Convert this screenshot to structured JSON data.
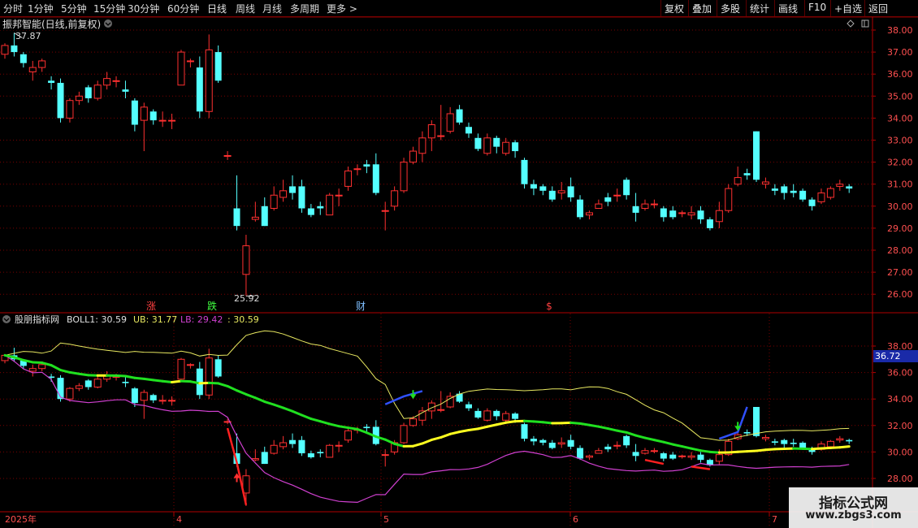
{
  "toolbar": {
    "periods": [
      "分时",
      "1分钟",
      "5分钟",
      "15分钟",
      "30分钟",
      "60分钟",
      "日线",
      "周线",
      "月线",
      "多周期",
      "更多 >"
    ],
    "active_period": "日线",
    "right_buttons": [
      "复权",
      "叠加",
      "多股",
      "统计",
      "画线",
      "F10",
      "+自选",
      "返回"
    ]
  },
  "main_panel": {
    "title": "振邦智能(日线,前复权)",
    "high_label": "37.87",
    "low_label": "25.92",
    "y_ticks": [
      "38.00",
      "37.00",
      "36.00",
      "35.00",
      "34.00",
      "33.00",
      "32.00",
      "31.00",
      "30.00",
      "29.00",
      "28.00",
      "27.00",
      "26.00"
    ],
    "event_markers": [
      {
        "text": "涨",
        "color": "#ff4040"
      },
      {
        "text": "跌",
        "color": "#40ff40"
      },
      {
        "text": "财",
        "color": "#7fbfff"
      },
      {
        "text": "$",
        "color": "#ff4040"
      }
    ]
  },
  "indicator_panel": {
    "name": "股朋指标网",
    "boll": "BOLL1: 30.59",
    "ub": "UB: 31.77",
    "lb": "LB: 29.42",
    "extra": ": 30.59",
    "y_ticks": [
      "38.00",
      "36.00",
      "34.00",
      "32.00",
      "30.00",
      "28.00"
    ],
    "current_price_label": "36.72"
  },
  "x_axis": {
    "labels": [
      "2025年",
      "4",
      "5",
      "6",
      "7"
    ]
  },
  "watermark": {
    "title": "指标公式网",
    "url": "www.zbgs3.com"
  },
  "colors": {
    "up": "#ff3030",
    "down": "#54ffff",
    "ub": "#e8e860",
    "lb": "#d040d0",
    "mid_green": "#20e020",
    "mid_yellow": "#ffff20",
    "grid": "#7a0000"
  },
  "candles": [
    [
      36.9,
      37.3,
      37.4,
      36.7
    ],
    [
      37.3,
      37.0,
      37.87,
      36.8
    ],
    [
      36.9,
      36.5,
      37.0,
      36.3
    ],
    [
      36.1,
      36.3,
      36.6,
      35.7
    ],
    [
      36.3,
      36.6,
      36.7,
      36.1
    ],
    [
      35.7,
      35.6,
      35.9,
      35.3
    ],
    [
      35.6,
      34.0,
      35.8,
      33.8
    ],
    [
      34.0,
      34.8,
      34.9,
      33.8
    ],
    [
      34.8,
      35.0,
      35.2,
      34.6
    ],
    [
      35.4,
      34.9,
      35.5,
      34.7
    ],
    [
      34.9,
      35.5,
      35.7,
      34.8
    ],
    [
      35.5,
      35.8,
      36.1,
      35.3
    ],
    [
      35.7,
      35.7,
      35.9,
      35.4
    ],
    [
      35.3,
      35.2,
      35.7,
      34.9
    ],
    [
      34.8,
      33.7,
      34.9,
      33.4
    ],
    [
      33.9,
      34.5,
      34.7,
      32.5
    ],
    [
      34.3,
      33.9,
      34.4,
      33.7
    ],
    [
      33.9,
      33.9,
      34.3,
      33.6
    ],
    [
      33.9,
      33.9,
      34.2,
      33.5
    ],
    [
      35.5,
      37.0,
      37.1,
      35.5
    ],
    [
      36.6,
      36.6,
      36.7,
      36.3
    ],
    [
      36.3,
      34.3,
      36.8,
      34.0
    ],
    [
      34.3,
      37.1,
      37.8,
      34.0
    ],
    [
      37.0,
      35.7,
      37.3,
      35.6
    ],
    [
      32.3,
      32.3,
      32.5,
      32.1
    ],
    [
      29.9,
      29.1,
      31.4,
      28.9
    ],
    [
      26.9,
      28.2,
      28.7,
      25.92
    ],
    [
      29.4,
      29.5,
      30.2,
      29.3
    ],
    [
      30.0,
      29.1,
      30.4,
      29.1
    ],
    [
      29.9,
      30.5,
      30.9,
      29.8
    ],
    [
      30.4,
      30.7,
      31.2,
      30.2
    ],
    [
      30.9,
      30.6,
      31.4,
      30.3
    ],
    [
      30.9,
      29.9,
      31.2,
      29.7
    ],
    [
      29.9,
      29.6,
      30.1,
      29.5
    ],
    [
      30.0,
      29.9,
      30.2,
      29.6
    ],
    [
      29.6,
      30.5,
      30.6,
      29.6
    ],
    [
      30.5,
      30.5,
      30.8,
      30.0
    ],
    [
      30.9,
      31.6,
      31.8,
      30.7
    ],
    [
      31.7,
      31.7,
      31.9,
      31.4
    ],
    [
      31.9,
      31.8,
      32.1,
      31.5
    ],
    [
      31.9,
      30.6,
      32.4,
      30.5
    ],
    [
      29.8,
      29.8,
      30.2,
      28.9
    ],
    [
      30.0,
      30.7,
      30.9,
      29.8
    ],
    [
      30.7,
      32.0,
      32.2,
      30.6
    ],
    [
      32.0,
      32.5,
      32.7,
      31.9
    ],
    [
      32.4,
      33.1,
      33.4,
      32.0
    ],
    [
      33.1,
      33.7,
      33.9,
      32.5
    ],
    [
      33.2,
      33.2,
      34.6,
      33.0
    ],
    [
      33.4,
      34.2,
      34.5,
      33.3
    ],
    [
      34.4,
      33.8,
      34.6,
      33.7
    ],
    [
      33.6,
      33.3,
      33.8,
      33.1
    ],
    [
      33.1,
      32.6,
      33.3,
      32.5
    ],
    [
      32.4,
      33.1,
      33.3,
      32.3
    ],
    [
      33.1,
      32.7,
      33.2,
      32.4
    ],
    [
      32.4,
      32.9,
      33.1,
      32.3
    ],
    [
      32.9,
      32.5,
      33.0,
      32.2
    ],
    [
      32.1,
      31.0,
      32.2,
      30.8
    ],
    [
      31.0,
      30.8,
      31.2,
      30.5
    ],
    [
      30.9,
      30.7,
      31.0,
      30.5
    ],
    [
      30.7,
      30.3,
      30.9,
      30.2
    ],
    [
      30.6,
      30.7,
      31.1,
      30.3
    ],
    [
      30.9,
      30.4,
      31.3,
      30.2
    ],
    [
      30.3,
      29.5,
      30.5,
      29.4
    ],
    [
      29.6,
      29.7,
      29.8,
      29.4
    ],
    [
      29.9,
      30.1,
      30.3,
      29.9
    ],
    [
      30.4,
      30.2,
      30.6,
      30.0
    ],
    [
      30.5,
      30.5,
      30.8,
      30.2
    ],
    [
      31.2,
      30.5,
      31.3,
      30.3
    ],
    [
      30.0,
      29.7,
      30.6,
      29.3
    ],
    [
      29.9,
      30.1,
      30.3,
      29.8
    ],
    [
      30.1,
      30.1,
      30.3,
      29.9
    ],
    [
      29.9,
      29.5,
      30.0,
      29.3
    ],
    [
      29.8,
      29.5,
      30.0,
      29.4
    ],
    [
      29.7,
      29.7,
      29.8,
      29.5
    ],
    [
      29.6,
      29.7,
      30.0,
      29.4
    ],
    [
      29.8,
      29.4,
      30.0,
      29.2
    ],
    [
      29.4,
      29.0,
      29.5,
      28.9
    ],
    [
      29.3,
      29.8,
      30.2,
      29.0
    ],
    [
      29.8,
      30.8,
      31.0,
      29.7
    ],
    [
      31.0,
      31.3,
      31.8,
      30.9
    ],
    [
      31.5,
      31.4,
      31.7,
      31.2
    ],
    [
      33.4,
      31.2,
      33.4,
      31.1
    ],
    [
      31.0,
      31.1,
      31.3,
      30.8
    ],
    [
      30.8,
      30.7,
      31.0,
      30.5
    ],
    [
      30.9,
      30.6,
      31.0,
      30.3
    ],
    [
      30.7,
      30.6,
      31.0,
      30.4
    ],
    [
      30.7,
      30.3,
      30.8,
      30.2
    ],
    [
      30.3,
      30.0,
      30.4,
      29.8
    ],
    [
      30.2,
      30.6,
      30.8,
      30.1
    ],
    [
      30.4,
      30.8,
      30.9,
      30.3
    ],
    [
      30.9,
      31.0,
      31.2,
      30.7
    ],
    [
      30.9,
      30.8,
      31.0,
      30.6
    ]
  ]
}
